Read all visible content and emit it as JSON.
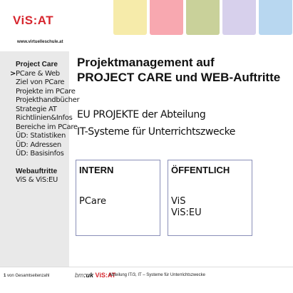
{
  "brand": {
    "logo": "ViS:AT",
    "url": "www.virtuelleschule.at",
    "logo_color": "#d7262e"
  },
  "tabs": [
    {
      "color": "#ffffff"
    },
    {
      "color": "#f6ebaa"
    },
    {
      "color": "#f8a8b0"
    },
    {
      "color": "#c9d19a"
    },
    {
      "color": "#d7d0ec"
    },
    {
      "color": "#b8d7f0"
    }
  ],
  "sidebar": {
    "sections": [
      {
        "title": "Project Care",
        "items": [
          {
            "label": "PCare & Web",
            "current": true,
            "marker": ">"
          },
          {
            "label": "Ziel von PCare"
          },
          {
            "label": "Projekte im PCare"
          },
          {
            "label": "Projekthandbücher"
          },
          {
            "label": "Strategie AT"
          },
          {
            "label": "Richtlinien&Infos"
          },
          {
            "label": "Bereiche im PCare"
          },
          {
            "label": "ÜD: Statistiken"
          },
          {
            "label": "ÜD: Adressen"
          },
          {
            "label": "ÜD: Basisinfos"
          }
        ]
      },
      {
        "title": "Webauftritte",
        "items": [
          {
            "label": "ViS & ViS:EU"
          }
        ]
      }
    ]
  },
  "main": {
    "title_line1": "Projektmanagement auf",
    "title_line2": "PROJECT CARE und WEB-Auftritte",
    "subtitle_line1": "EU PROJEKTE der Abteilung",
    "subtitle_line2": "IT-Systeme für Unterrichtszwecke",
    "cards": [
      {
        "title": "INTERN",
        "lines": [
          "PCare"
        ]
      },
      {
        "title": "ÖFFENTLICH",
        "lines": [
          "ViS",
          "ViS:EU"
        ]
      }
    ]
  },
  "footer": {
    "page_number": "1",
    "page_suffix": "von Gesamtseitenzahl",
    "logo_bm": "bm",
    "logo_uk": ":uk",
    "logo_vis": "ViS:AT",
    "text": "Abteilung IT/3, IT – Systeme für Unterrichtszwecke"
  }
}
